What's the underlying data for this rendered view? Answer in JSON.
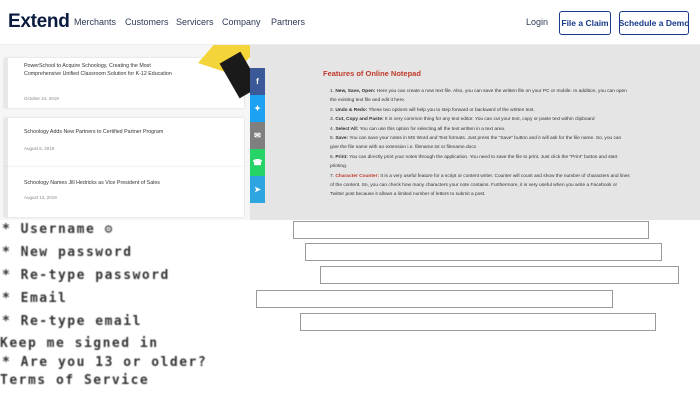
{
  "header": {
    "logo": "Extend",
    "nav": [
      "Merchants",
      "Customers",
      "Servicers",
      "Company",
      "Partners"
    ],
    "login": "Login",
    "file_claim": "File a Claim",
    "schedule_demo": "Schedule a Demo"
  },
  "blog": {
    "posts": [
      {
        "title": "PowerSchool to Acquire Schoology, Creating the Most Comprehensive Unified Classroom Solution for K-12 Education",
        "date": "October 24, 2019"
      },
      {
        "title": "Schoology Adds New Partners to Certified Partner Program",
        "date": "August 6, 2019"
      },
      {
        "title": "Schoology Names Jill Hedricks as Vice President of Sales",
        "date": "August 13, 2019"
      }
    ]
  },
  "share": {
    "icons": [
      "facebook-icon",
      "twitter-icon",
      "email-icon",
      "whatsapp-icon",
      "telegram-icon"
    ],
    "colors": [
      "#3b5998",
      "#1da1f2",
      "#7f7f7f",
      "#25d366",
      "#2ca5e0"
    ]
  },
  "features": {
    "title": "Features of Online Notepad",
    "items": [
      {
        "head": "New, Save, Open:",
        "text": " Here you can create a new text file. Also, you can save the written file on your PC or mobile. In addition, you can open the existing text file and edit it here."
      },
      {
        "head": "Undo & Redo:",
        "text": " These two options will help you to step forward or backward of the written text."
      },
      {
        "head": "Cut, Copy and Paste:",
        "text": " It is very common thing for any text editor. You can cut your text, copy or paste text within clipboard"
      },
      {
        "head": "Select All:",
        "text": " You can use this option for selecting all the text written in a text area."
      },
      {
        "head": "Save:",
        "text": " You can save your notes in MS Word and Text formats. Just press the \"Save\" button and it will ask for the file name. So, you can give the file name with an extension i.e. filename.txt or filename.docx"
      },
      {
        "head": "Print:",
        "text": " You can directly print your notes through the application. You need to save the file to print. Just click the \"Print\" button and start printing."
      },
      {
        "head": "Character Counter:",
        "text": " It is a very useful feature for a script or content writer. Counter will count and show the number of characters and lines of the content. So, you can check how many characters your note contains. Furthermore, it is very useful when you write a Facebook or Twitter post because it allows a limited number of letters to submit a post.",
        "red": true
      }
    ]
  },
  "form": {
    "fields": [
      {
        "label": "* Username ⚙"
      },
      {
        "label": "* New password"
      },
      {
        "label": "* Re-type password"
      },
      {
        "label": "* Email"
      },
      {
        "label": "* Re-type email"
      }
    ],
    "keep_signed_in": "Keep me signed in",
    "age_question": "* Are you 13 or older?",
    "terms": "Terms of Service"
  }
}
